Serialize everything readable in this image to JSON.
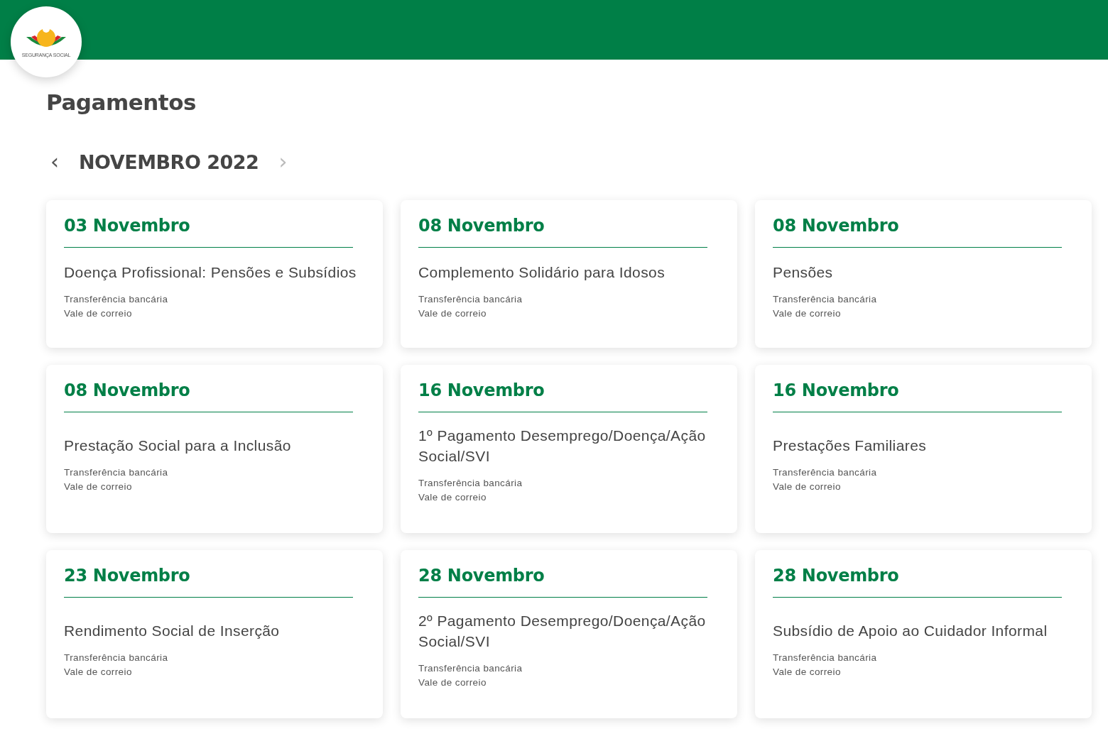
{
  "header": {
    "logo_text": "SEGURANÇA SOCIAL"
  },
  "title": "Pagamentos",
  "month_nav": {
    "prev": "‹",
    "label": "NOVEMBRO 2022",
    "next": "›"
  },
  "payments": [
    {
      "date": "03 Novembro",
      "name": "Doença Profissional: Pensões e Subsídios",
      "methods": [
        "Transferência bancária",
        "Vale de correio"
      ]
    },
    {
      "date": "08 Novembro",
      "name": "Complemento Solidário para Idosos",
      "methods": [
        "Transferência bancária",
        "Vale de correio"
      ]
    },
    {
      "date": "08 Novembro",
      "name": "Pensões",
      "methods": [
        "Transferência bancária",
        "Vale de correio"
      ]
    },
    {
      "date": "08 Novembro",
      "name": "Prestação Social para a Inclusão",
      "methods": [
        "Transferência bancária",
        "Vale de correio"
      ]
    },
    {
      "date": "16 Novembro",
      "name": "1º Pagamento Desemprego/Doença/Ação Social/SVI",
      "methods": [
        "Transferência bancária",
        "Vale de correio"
      ]
    },
    {
      "date": "16 Novembro",
      "name": "Prestações Familiares",
      "methods": [
        "Transferência bancária",
        "Vale de correio"
      ]
    },
    {
      "date": "23 Novembro",
      "name": "Rendimento Social de Inserção",
      "methods": [
        "Transferência bancária",
        "Vale de correio"
      ]
    },
    {
      "date": "28 Novembro",
      "name": "2º Pagamento Desemprego/Doença/Ação Social/SVI",
      "methods": [
        "Transferência bancária",
        "Vale de correio"
      ]
    },
    {
      "date": "28 Novembro",
      "name": "Subsídio de Apoio ao Cuidador Informal",
      "methods": [
        "Transferência bancária",
        "Vale de correio"
      ]
    }
  ]
}
